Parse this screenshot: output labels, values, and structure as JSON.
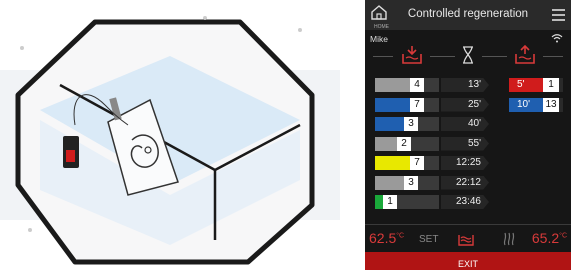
{
  "header": {
    "home_label": "HOME",
    "title": "Controlled regeneration"
  },
  "user": "Mike",
  "phase_icons": [
    "heat-down-icon",
    "hourglass-icon",
    "heat-up-icon"
  ],
  "steps": [
    {
      "value": "4",
      "time": "13'",
      "color": "#9a9a9a",
      "fill": 0.55
    },
    {
      "value": "7",
      "time": "25'",
      "color": "#1f5fb0",
      "fill": 0.55
    },
    {
      "value": "3",
      "time": "40'",
      "color": "#1f5fb0",
      "fill": 0.45
    },
    {
      "value": "2",
      "time": "55'",
      "color": "#9a9a9a",
      "fill": 0.35
    },
    {
      "value": "7",
      "time": "12:25",
      "color": "#e8e800",
      "fill": 0.55
    },
    {
      "value": "3",
      "time": "22:12",
      "color": "#9a9a9a",
      "fill": 0.45
    },
    {
      "value": "1",
      "time": "23:46",
      "color": "#1aa83a",
      "fill": 0.12
    }
  ],
  "side_steps": [
    {
      "time": "5'",
      "value": "1",
      "color": "#d01c1c"
    },
    {
      "time": "10'",
      "value": "13",
      "color": "#1f5fb0"
    }
  ],
  "temperatures": {
    "set_value": "62.5",
    "set_unit": "°C",
    "set_label": "SET",
    "current_value": "65.2",
    "current_unit": "°C"
  },
  "exit_label": "EXIT",
  "colors": {
    "accent_red": "#d83a3a",
    "exit_bg": "#b01414"
  }
}
